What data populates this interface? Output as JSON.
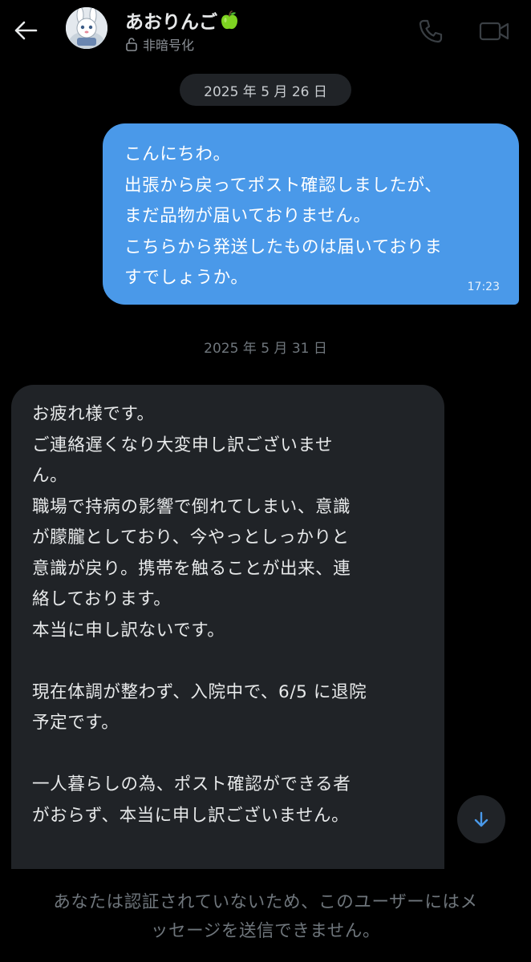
{
  "header": {
    "contact_name": "あおりんご",
    "name_emoji_icon": "green-apple-icon",
    "encryption_status": "非暗号化",
    "icons": [
      "back-arrow-icon",
      "lock-icon",
      "phone-icon",
      "video-camera-icon"
    ]
  },
  "colors": {
    "background": "#000000",
    "sent_bubble": "#4a99e9",
    "received_bubble": "#202327",
    "muted_text": "#6f767c"
  },
  "messages": {
    "date1": "2025 年 5 月 26 日",
    "sent": {
      "lines": [
        "こんにちわ。",
        "出張から戻ってポスト確認しましたが、",
        "まだ品物が届いておりません。",
        "こちらから発送したものは届いておりま",
        "すでしょうか。"
      ],
      "time": "17:23"
    },
    "date2": "2025 年 5 月 31 日",
    "received": {
      "lines": [
        "お疲れ様です。",
        "ご連絡遅くなり大変申し訳ございませ",
        "ん。",
        "職場で持病の影響で倒れてしまい、意識",
        "が朦朧としており、今やっとしっかりと",
        "意識が戻り。携帯を触ることが出来、連",
        "絡しております。",
        "本当に申し訳ないです。",
        "",
        "現在体調が整わず、入院中で、6/5 に退院",
        "予定です。",
        "",
        "一人暮らしの為、ポスト確認ができる者",
        "がおらず、本当に申し訳ございません。"
      ]
    }
  },
  "footer": {
    "notice_lines": [
      "あなたは認証されていないため、このユーザーにはメ",
      "ッセージを送信できません。"
    ]
  }
}
